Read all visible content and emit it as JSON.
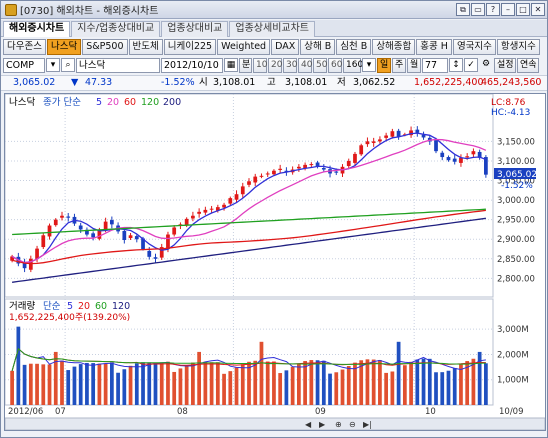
{
  "window": {
    "title": "[0730] 해외차트 - 해외증시차트",
    "buttons": [
      "⧉",
      "▭",
      "?",
      "–",
      "□",
      "✕"
    ]
  },
  "tabs": [
    {
      "label": "해외증시차트",
      "active": true
    },
    {
      "label": "지수/업종상대비교",
      "active": false
    },
    {
      "label": "업종상대비교",
      "active": false
    },
    {
      "label": "업종상세비교차트",
      "active": false
    }
  ],
  "index_buttons": [
    {
      "label": "다우존스",
      "active": false
    },
    {
      "label": "나스닥",
      "active": true
    },
    {
      "label": "S&P500",
      "active": false
    },
    {
      "label": "반도체",
      "active": false
    },
    {
      "label": "니케이225",
      "active": false
    },
    {
      "label": "Weighted",
      "active": false
    },
    {
      "label": "DAX",
      "active": false
    },
    {
      "label": "상해 B",
      "active": false
    },
    {
      "label": "심천 B",
      "active": false
    },
    {
      "label": "상해종합",
      "active": false
    },
    {
      "label": "홍콩 H",
      "active": false
    },
    {
      "label": "영국지수",
      "active": false
    },
    {
      "label": "항생지수",
      "active": false
    }
  ],
  "controls": {
    "symbol_code": "COMP",
    "symbol_name": "나스닥",
    "date": "2012/10/10",
    "period_buttons": [
      "분",
      "10",
      "20",
      "30",
      "40",
      "50",
      "60",
      "160"
    ],
    "day_button": "일",
    "week_button": "주",
    "month_button": "월",
    "count": "77",
    "settings_label": "설정",
    "continuous_label": "연속"
  },
  "price_info": {
    "price": "3,065.02",
    "change": "47.33",
    "change_pct": "-1.52%",
    "open_label": "시",
    "open": "3,108.01",
    "high_label": "고",
    "high": "3,108.01",
    "low_label": "저",
    "low": "3,062.52",
    "volume1": "1,652,225,400",
    "volume2": "465,243,560"
  },
  "chart_data": [
    {
      "type": "candlestick",
      "name": "나스닥",
      "legend": [
        "나스닥",
        "종가 단순",
        "5",
        "20",
        "60",
        "120",
        "200"
      ],
      "ylim": [
        2760,
        3220
      ],
      "y_ticks": [
        "3,150.00",
        "3,100.00",
        "3,050.00",
        "3,000.00",
        "2,950.00",
        "2,900.00",
        "2,850.00",
        "2,800.00"
      ],
      "y_tick_values": [
        3150,
        3100,
        3050,
        3000,
        2950,
        2900,
        2850,
        2800
      ],
      "annotations": {
        "lc": "LC:8.76",
        "hc": "HC:-4.13",
        "last_price": "3,065.02",
        "last_pct": "-1.52%"
      },
      "closes": [
        2856,
        2838,
        2826,
        2850,
        2876,
        2910,
        2935,
        2950,
        2960,
        2955,
        2940,
        2925,
        2912,
        2905,
        2925,
        2945,
        2938,
        2920,
        2898,
        2910,
        2900,
        2875,
        2855,
        2850,
        2880,
        2912,
        2930,
        2938,
        2952,
        2960,
        2970,
        2975,
        2978,
        2982,
        2988,
        3005,
        3015,
        3035,
        3048,
        3060,
        3062,
        3068,
        3075,
        3080,
        3072,
        3078,
        3085,
        3090,
        3092,
        3085,
        3078,
        3068,
        3070,
        3085,
        3100,
        3118,
        3140,
        3150,
        3150,
        3155,
        3165,
        3176,
        3162,
        3168,
        3178,
        3172,
        3160,
        3150,
        3125,
        3110,
        3102,
        3098,
        3108,
        3112,
        3125,
        3108,
        3065
      ],
      "series": [
        {
          "name": "5",
          "color": "#3030d8"
        },
        {
          "name": "20",
          "color": "#e040c0"
        },
        {
          "name": "60",
          "color": "#e01818"
        },
        {
          "name": "120",
          "color": "#20a020"
        },
        {
          "name": "200",
          "color": "#202080"
        }
      ]
    },
    {
      "type": "bar",
      "name": "거래량",
      "legend": [
        "거래량",
        "단순",
        "5",
        "20",
        "60",
        "120"
      ],
      "value_label": "1,652,225,400주(139.20%)",
      "ylim": [
        0,
        3600000000
      ],
      "y_ticks": [
        "3,000M",
        "2,000M",
        "1,000M"
      ],
      "y_tick_values": [
        3000000000,
        2000000000,
        1000000000
      ],
      "x_labels": [
        "2012/06",
        "07",
        "08",
        "09",
        "10",
        "10/09"
      ]
    }
  ]
}
